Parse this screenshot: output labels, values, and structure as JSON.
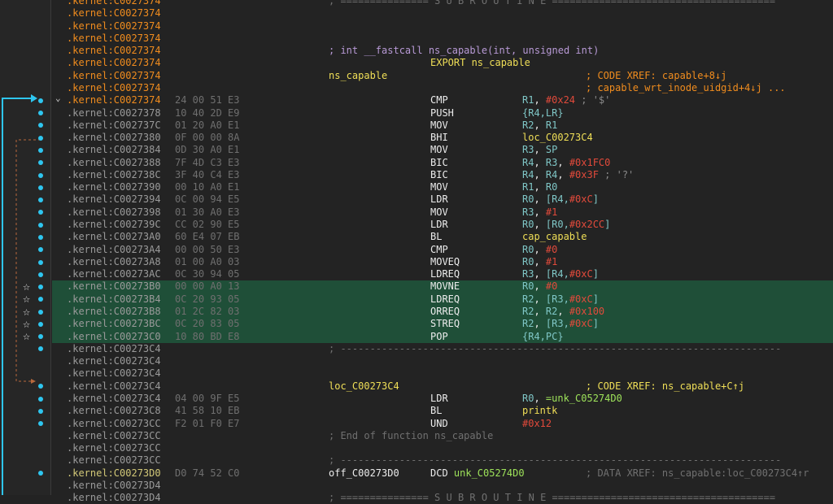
{
  "colors": {
    "background": "#232323",
    "highlight": "#1f4f38",
    "segment_orange": "#f08c1e",
    "register": "#7fc6c6",
    "immediate": "#e24a3b",
    "label": "#f0df57",
    "export": "#f0df57",
    "green_symbol": "#9ee35a",
    "comment": "#8a8a8a",
    "arrow_cyan": "#2ec6f0",
    "arrow_brown": "#b8683c"
  },
  "icons": {
    "collapse": "chevron-down-icon",
    "bookmark": "star-icon",
    "breakpoint_dot": "dot-icon"
  },
  "lines": [
    {
      "addr": ".kernel:C0027374",
      "seg": "o",
      "c2": "; =============== S U B R O U T I N E ======================================",
      "c2cls": "grey"
    },
    {
      "addr": ".kernel:C0027374",
      "seg": "o"
    },
    {
      "addr": ".kernel:C0027374",
      "seg": "o"
    },
    {
      "addr": ".kernel:C0027374",
      "seg": "o"
    },
    {
      "addr": ".kernel:C0027374",
      "seg": "o",
      "c2": "; int __fastcall ns_capable(int, unsigned int)",
      "c2cls": "purple"
    },
    {
      "addr": ".kernel:C0027374",
      "seg": "o",
      "mnem": "EXPORT ns_capable",
      "mnemcls": "yellow"
    },
    {
      "addr": ".kernel:C0027374",
      "seg": "o",
      "c2": "ns_capable",
      "c2cls": "yellow",
      "cmt": "; CODE XREF: capable+8↓j",
      "cmtcls": "orange"
    },
    {
      "addr": ".kernel:C0027374",
      "seg": "o",
      "cmt": "; capable_wrt_inode_uidgid+4↓j ...",
      "cmtcls": "orange"
    },
    {
      "addr": ".kernel:C0027374",
      "seg": "o",
      "bytes": "24 00 51 E3",
      "mnem": "CMP",
      "ops": [
        [
          "R1",
          "reg"
        ],
        [
          ", ",
          "white"
        ],
        [
          "#0x24",
          "imm"
        ],
        [
          " ; '$'",
          "cmt"
        ]
      ],
      "chev": true
    },
    {
      "addr": ".kernel:C0027378",
      "bytes": "10 40 2D E9",
      "mnem": "PUSH",
      "ops": [
        [
          "{R4,LR}",
          "reg"
        ]
      ]
    },
    {
      "addr": ".kernel:C002737C",
      "bytes": "01 20 A0 E1",
      "mnem": "MOV",
      "ops": [
        [
          "R2",
          "reg"
        ],
        [
          ", ",
          "white"
        ],
        [
          "R1",
          "reg"
        ]
      ]
    },
    {
      "addr": ".kernel:C0027380",
      "bytes": "0F 00 00 8A",
      "mnem": "BHI",
      "ops": [
        [
          "loc_C00273C4",
          "lab"
        ]
      ]
    },
    {
      "addr": ".kernel:C0027384",
      "bytes": "0D 30 A0 E1",
      "mnem": "MOV",
      "ops": [
        [
          "R3",
          "reg"
        ],
        [
          ", ",
          "white"
        ],
        [
          "SP",
          "reg"
        ]
      ]
    },
    {
      "addr": ".kernel:C0027388",
      "bytes": "7F 4D C3 E3",
      "mnem": "BIC",
      "ops": [
        [
          "R4",
          "reg"
        ],
        [
          ", ",
          "white"
        ],
        [
          "R3",
          "reg"
        ],
        [
          ", ",
          "white"
        ],
        [
          "#0x1FC0",
          "imm"
        ]
      ]
    },
    {
      "addr": ".kernel:C002738C",
      "bytes": "3F 40 C4 E3",
      "mnem": "BIC",
      "ops": [
        [
          "R4",
          "reg"
        ],
        [
          ", ",
          "white"
        ],
        [
          "R4",
          "reg"
        ],
        [
          ", ",
          "white"
        ],
        [
          "#0x3F",
          "imm"
        ],
        [
          " ; '?'",
          "cmt"
        ]
      ]
    },
    {
      "addr": ".kernel:C0027390",
      "bytes": "00 10 A0 E1",
      "mnem": "MOV",
      "ops": [
        [
          "R1",
          "reg"
        ],
        [
          ", ",
          "white"
        ],
        [
          "R0",
          "reg"
        ]
      ]
    },
    {
      "addr": ".kernel:C0027394",
      "bytes": "0C 00 94 E5",
      "mnem": "LDR",
      "ops": [
        [
          "R0",
          "reg"
        ],
        [
          ", ",
          "white"
        ],
        [
          "[R4,",
          "reg"
        ],
        [
          "#0xC",
          "imm"
        ],
        [
          "]",
          "reg"
        ]
      ]
    },
    {
      "addr": ".kernel:C0027398",
      "bytes": "01 30 A0 E3",
      "mnem": "MOV",
      "ops": [
        [
          "R3",
          "reg"
        ],
        [
          ", ",
          "white"
        ],
        [
          "#1",
          "imm"
        ]
      ]
    },
    {
      "addr": ".kernel:C002739C",
      "bytes": "CC 02 90 E5",
      "mnem": "LDR",
      "ops": [
        [
          "R0",
          "reg"
        ],
        [
          ", ",
          "white"
        ],
        [
          "[R0,",
          "reg"
        ],
        [
          "#0x2CC",
          "imm"
        ],
        [
          "]",
          "reg"
        ]
      ]
    },
    {
      "addr": ".kernel:C00273A0",
      "bytes": "60 E4 07 EB",
      "mnem": "BL",
      "ops": [
        [
          "cap_capable",
          "lab"
        ]
      ]
    },
    {
      "addr": ".kernel:C00273A4",
      "bytes": "00 00 50 E3",
      "mnem": "CMP",
      "ops": [
        [
          "R0",
          "reg"
        ],
        [
          ", ",
          "white"
        ],
        [
          "#0",
          "imm"
        ]
      ]
    },
    {
      "addr": ".kernel:C00273A8",
      "bytes": "01 00 A0 03",
      "mnem": "MOVEQ",
      "ops": [
        [
          "R0",
          "reg"
        ],
        [
          ", ",
          "white"
        ],
        [
          "#1",
          "imm"
        ]
      ]
    },
    {
      "addr": ".kernel:C00273AC",
      "bytes": "0C 30 94 05",
      "mnem": "LDREQ",
      "ops": [
        [
          "R3",
          "reg"
        ],
        [
          ", ",
          "white"
        ],
        [
          "[R4,",
          "reg"
        ],
        [
          "#0xC",
          "imm"
        ],
        [
          "]",
          "reg"
        ]
      ]
    },
    {
      "addr": ".kernel:C00273B0",
      "bytes": "00 00 A0 13",
      "mnem": "MOVNE",
      "ops": [
        [
          "R0",
          "reg"
        ],
        [
          ", ",
          "white"
        ],
        [
          "#0",
          "imm"
        ]
      ],
      "hl": true,
      "star": true
    },
    {
      "addr": ".kernel:C00273B4",
      "bytes": "0C 20 93 05",
      "mnem": "LDREQ",
      "ops": [
        [
          "R2",
          "reg"
        ],
        [
          ", ",
          "white"
        ],
        [
          "[R3,",
          "reg"
        ],
        [
          "#0xC",
          "imm"
        ],
        [
          "]",
          "reg"
        ]
      ],
      "hl": true,
      "star": true
    },
    {
      "addr": ".kernel:C00273B8",
      "bytes": "01 2C 82 03",
      "mnem": "ORREQ",
      "ops": [
        [
          "R2",
          "reg"
        ],
        [
          ", ",
          "white"
        ],
        [
          "R2",
          "reg"
        ],
        [
          ", ",
          "white"
        ],
        [
          "#0x100",
          "imm"
        ]
      ],
      "hl": true,
      "star": true
    },
    {
      "addr": ".kernel:C00273BC",
      "bytes": "0C 20 83 05",
      "mnem": "STREQ",
      "ops": [
        [
          "R2",
          "reg"
        ],
        [
          ", ",
          "white"
        ],
        [
          "[R3,",
          "reg"
        ],
        [
          "#0xC",
          "imm"
        ],
        [
          "]",
          "reg"
        ]
      ],
      "hl": true,
      "star": true
    },
    {
      "addr": ".kernel:C00273C0",
      "bytes": "10 80 BD E8",
      "mnem": "POP",
      "ops": [
        [
          "{R4,PC}",
          "reg"
        ]
      ],
      "hl": true,
      "star": true
    },
    {
      "addr": ".kernel:C00273C4",
      "c2": "; ---------------------------------------------------------------------------",
      "c2cls": "grey"
    },
    {
      "addr": ".kernel:C00273C4"
    },
    {
      "addr": ".kernel:C00273C4"
    },
    {
      "addr": ".kernel:C00273C4",
      "c2": "loc_C00273C4",
      "c2cls": "yellow",
      "cmt": "; CODE XREF: ns_capable+C↑j",
      "cmtcls": "yellow"
    },
    {
      "addr": ".kernel:C00273C4",
      "bytes": "04 00 9F E5",
      "mnem": "LDR",
      "ops": [
        [
          "R0",
          "reg"
        ],
        [
          ", ",
          "white"
        ],
        [
          "=unk_C05274D0",
          "green"
        ]
      ]
    },
    {
      "addr": ".kernel:C00273C8",
      "bytes": "41 58 10 EB",
      "mnem": "BL",
      "ops": [
        [
          "printk",
          "lab"
        ]
      ]
    },
    {
      "addr": ".kernel:C00273CC",
      "bytes": "F2 01 F0 E7",
      "mnem": "UND",
      "ops": [
        [
          "#0x12",
          "imm"
        ]
      ]
    },
    {
      "addr": ".kernel:C00273CC",
      "c2": "; End of function ns_capable",
      "c2cls": "grey"
    },
    {
      "addr": ".kernel:C00273CC"
    },
    {
      "addr": ".kernel:C00273CC",
      "c2": "; ---------------------------------------------------------------------------",
      "c2cls": "grey"
    },
    {
      "addr": ".kernel:C00273D0",
      "seg": "y",
      "bytes": "D0 74 52 C0",
      "c2": "off_C00273D0",
      "c2cls": "white",
      "mnem": "DCD unk_C05274D0",
      "mnemcls": "dcd",
      "cmt": "; DATA XREF: ns_capable:loc_C00273C4↑r",
      "cmtcls": "grey"
    },
    {
      "addr": ".kernel:C00273D4"
    },
    {
      "addr": ".kernel:C00273D4",
      "c2": "; =============== S U B R O U T I N E ======================================",
      "c2cls": "grey"
    }
  ]
}
